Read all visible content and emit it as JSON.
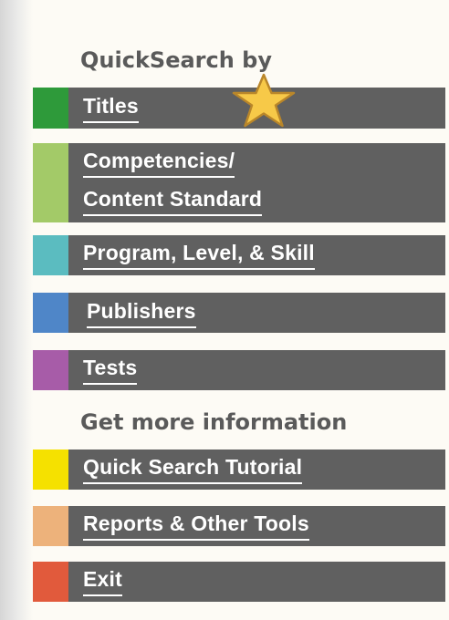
{
  "sections": {
    "quicksearch_heading": "QuickSearch by",
    "info_heading": "Get more information"
  },
  "nav": {
    "titles": "Titles",
    "competencies_line1": "Competencies/",
    "competencies_line2": "Content Standard",
    "program": "Program, Level, & Skill",
    "publishers": "Publishers",
    "tests": "Tests",
    "tutorial": "Quick Search Tutorial",
    "reports": "Reports & Other Tools",
    "exit": "Exit"
  },
  "colors": {
    "titles": "#2e9a3a",
    "competencies": "#a3ca68",
    "program": "#5bbcc0",
    "publishers": "#4f86c8",
    "tests": "#a75ca8",
    "tutorial": "#f5e100",
    "reports": "#edb27b",
    "exit": "#e15a3c",
    "bar": "#606060",
    "star": "#f7c948"
  },
  "icons": {
    "star": "star-icon"
  }
}
